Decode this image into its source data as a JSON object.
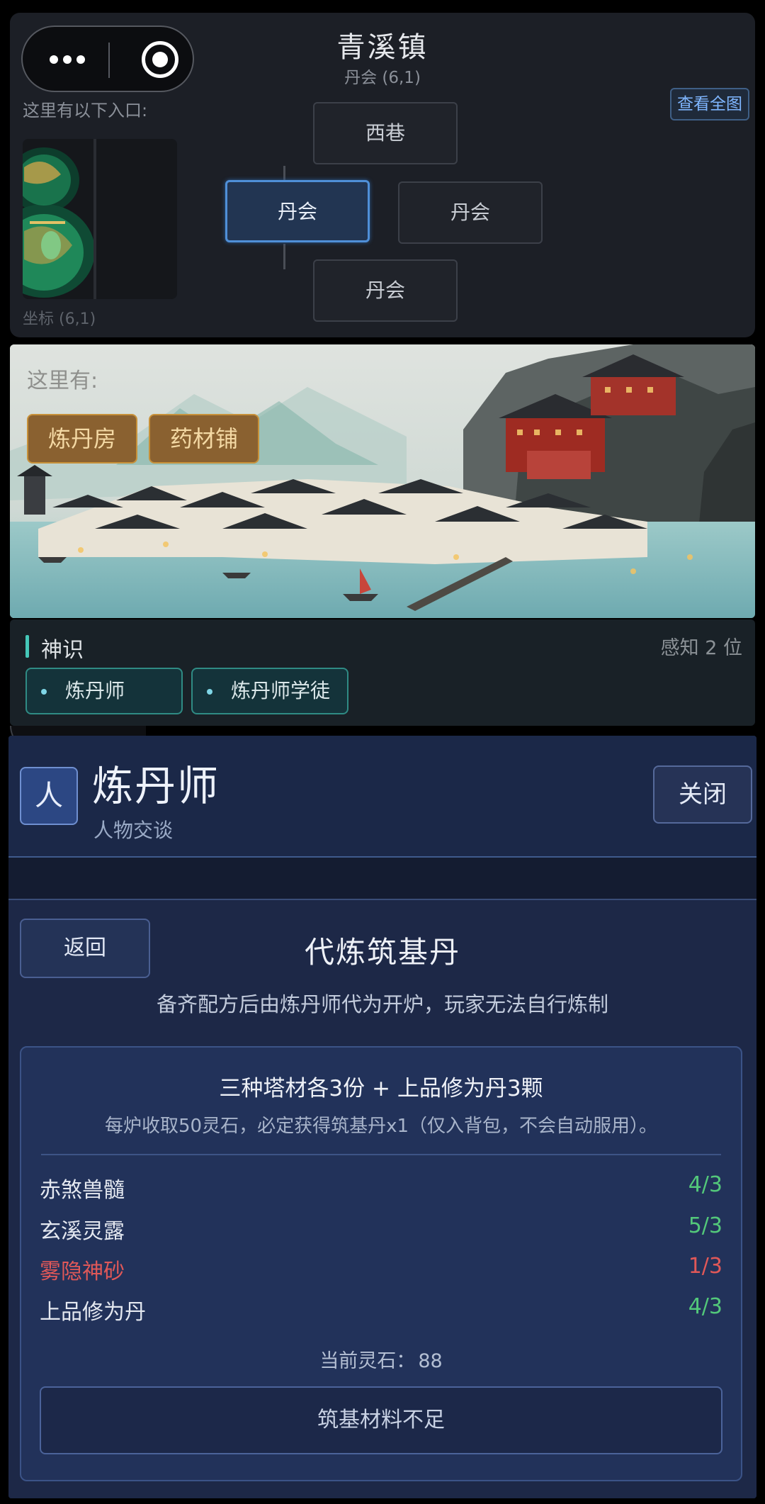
{
  "map": {
    "town_name": "青溪镇",
    "location": "丹会 (6,1)",
    "entrances_label": "这里有以下入口:",
    "view_full_map": "查看全图",
    "coordinate": "坐标 (6,1)",
    "nodes": {
      "north": "西巷",
      "current": "丹会",
      "east": "丹会",
      "south": "丹会"
    }
  },
  "scene": {
    "here_label": "这里有:",
    "places": [
      "炼丹房",
      "药材铺"
    ]
  },
  "sense": {
    "title": "神识",
    "count": "感知 2 位",
    "npcs": [
      "炼丹师",
      "炼丹师学徒"
    ]
  },
  "dialog": {
    "avatar_char": "人",
    "npc_name": "炼丹师",
    "subtitle": "人物交谈",
    "close_label": "关闭",
    "back_label": "返回",
    "recipe_title": "代炼筑基丹",
    "recipe_desc": "备齐配方后由炼丹师代为开炉，玩家无法自行炼制",
    "requirement": "三种塔材各3份 + 上品修为丹3颗",
    "note": "每炉收取50灵石，必定获得筑基丹x1（仅入背包，不会自动服用）。",
    "materials": [
      {
        "name": "赤煞兽髓",
        "count": "4/3",
        "status": "ok"
      },
      {
        "name": "玄溪灵露",
        "count": "5/3",
        "status": "ok"
      },
      {
        "name": "雾隐神砂",
        "count": "1/3",
        "status": "insufficient"
      },
      {
        "name": "上品修为丹",
        "count": "4/3",
        "status": "ok"
      }
    ],
    "stones_label": "当前灵石：",
    "stones_value": "88",
    "submit_label": "筑基材料不足"
  },
  "colors": {
    "ok": "#53c87a",
    "insufficient": "#e05858",
    "accent": "#4f8fd8",
    "place_button": "#8a6130"
  }
}
